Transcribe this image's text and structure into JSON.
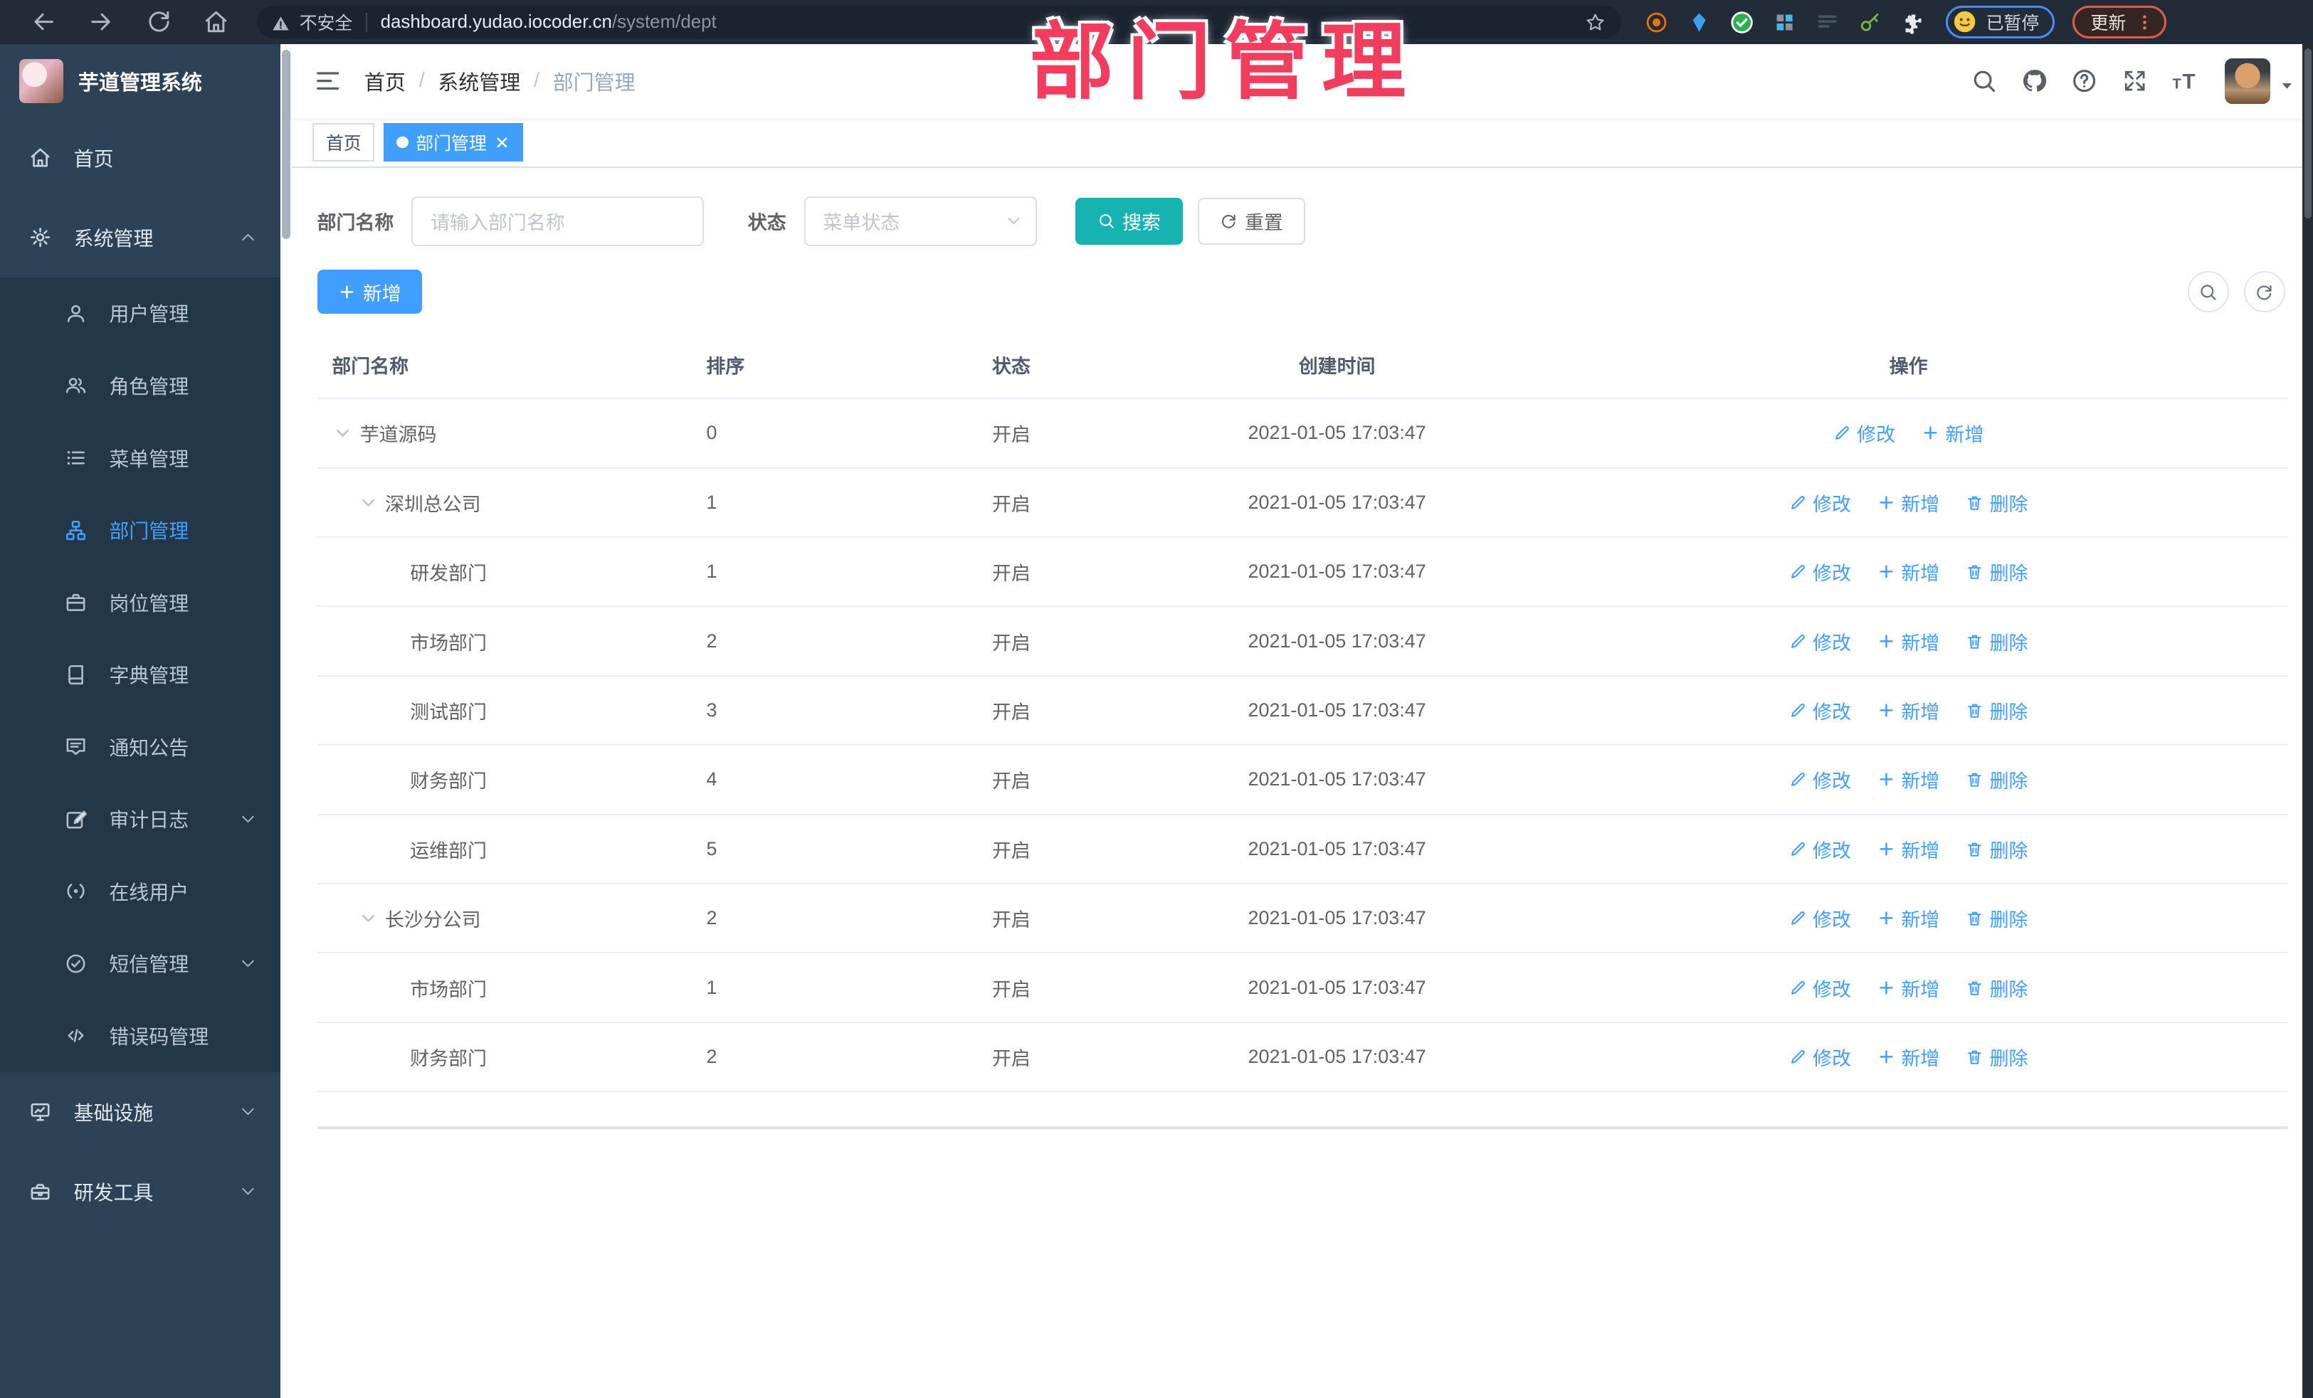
{
  "colors": {
    "accent": "#409eff",
    "search_button": "#17b3b3",
    "overlay_pink": "#f23d5f",
    "sidebar_bg": "#2d4257",
    "submenu_bg": "#243748",
    "toolbar_bg": "#222c38"
  },
  "overlay": {
    "title": "部门管理"
  },
  "browser": {
    "security_label": "不安全",
    "url_host": "dashboard.yudao.iocoder.cn",
    "url_path": "/system/dept",
    "extension_badge": "on",
    "profile_chip_label": "已暂停",
    "update_button_label": "更新"
  },
  "sidebar": {
    "app_title": "芋道管理系统",
    "sections": [
      {
        "type": "item",
        "icon": "home-icon",
        "label": "首页"
      },
      {
        "type": "group",
        "icon": "gear-icon",
        "label": "系统管理",
        "chevron": "up",
        "children": [
          {
            "icon": "user-icon",
            "label": "用户管理"
          },
          {
            "icon": "users-icon",
            "label": "角色管理"
          },
          {
            "icon": "menu-tree-icon",
            "label": "菜单管理"
          },
          {
            "icon": "org-icon",
            "label": "部门管理",
            "active": true
          },
          {
            "icon": "briefcase-icon",
            "label": "岗位管理"
          },
          {
            "icon": "dict-icon",
            "label": "字典管理"
          },
          {
            "icon": "notice-icon",
            "label": "通知公告"
          },
          {
            "icon": "audit-icon",
            "label": "审计日志",
            "chevron": "down"
          },
          {
            "icon": "online-icon",
            "label": "在线用户"
          },
          {
            "icon": "sms-icon",
            "label": "短信管理",
            "chevron": "down"
          },
          {
            "icon": "code-icon",
            "label": "错误码管理"
          }
        ]
      },
      {
        "type": "group",
        "icon": "infra-icon",
        "label": "基础设施",
        "chevron": "down",
        "children": []
      },
      {
        "type": "group",
        "icon": "tools-icon",
        "label": "研发工具",
        "chevron": "down",
        "children": []
      }
    ]
  },
  "navbar": {
    "breadcrumb": [
      "首页",
      "系统管理",
      "部门管理"
    ],
    "breadcrumb_separator": "/"
  },
  "tabs": [
    {
      "label": "首页"
    },
    {
      "label": "部门管理",
      "active": true,
      "closable": true
    }
  ],
  "filters": {
    "name_label": "部门名称",
    "name_placeholder": "请输入部门名称",
    "status_label": "状态",
    "status_placeholder": "菜单状态",
    "search_label": "搜索",
    "reset_label": "重置"
  },
  "toolbar": {
    "add_label": "新增"
  },
  "table": {
    "columns": [
      "部门名称",
      "排序",
      "状态",
      "创建时间",
      "操作"
    ],
    "action_labels": {
      "edit": "修改",
      "add": "新增",
      "delete": "删除"
    },
    "rows": [
      {
        "name": "芋道源码",
        "level": 0,
        "expandable": true,
        "sort": "0",
        "status": "开启",
        "created": "2021-01-05 17:03:47",
        "actions": [
          "edit",
          "add"
        ]
      },
      {
        "name": "深圳总公司",
        "level": 1,
        "expandable": true,
        "sort": "1",
        "status": "开启",
        "created": "2021-01-05 17:03:47",
        "actions": [
          "edit",
          "add",
          "delete"
        ]
      },
      {
        "name": "研发部门",
        "level": 2,
        "expandable": false,
        "sort": "1",
        "status": "开启",
        "created": "2021-01-05 17:03:47",
        "actions": [
          "edit",
          "add",
          "delete"
        ]
      },
      {
        "name": "市场部门",
        "level": 2,
        "expandable": false,
        "sort": "2",
        "status": "开启",
        "created": "2021-01-05 17:03:47",
        "actions": [
          "edit",
          "add",
          "delete"
        ]
      },
      {
        "name": "测试部门",
        "level": 2,
        "expandable": false,
        "sort": "3",
        "status": "开启",
        "created": "2021-01-05 17:03:47",
        "actions": [
          "edit",
          "add",
          "delete"
        ]
      },
      {
        "name": "财务部门",
        "level": 2,
        "expandable": false,
        "sort": "4",
        "status": "开启",
        "created": "2021-01-05 17:03:47",
        "actions": [
          "edit",
          "add",
          "delete"
        ]
      },
      {
        "name": "运维部门",
        "level": 2,
        "expandable": false,
        "sort": "5",
        "status": "开启",
        "created": "2021-01-05 17:03:47",
        "actions": [
          "edit",
          "add",
          "delete"
        ]
      },
      {
        "name": "长沙分公司",
        "level": 1,
        "expandable": true,
        "sort": "2",
        "status": "开启",
        "created": "2021-01-05 17:03:47",
        "actions": [
          "edit",
          "add",
          "delete"
        ]
      },
      {
        "name": "市场部门",
        "level": 2,
        "expandable": false,
        "sort": "1",
        "status": "开启",
        "created": "2021-01-05 17:03:47",
        "actions": [
          "edit",
          "add",
          "delete"
        ]
      },
      {
        "name": "财务部门",
        "level": 2,
        "expandable": false,
        "sort": "2",
        "status": "开启",
        "created": "2021-01-05 17:03:47",
        "actions": [
          "edit",
          "add",
          "delete"
        ]
      }
    ]
  }
}
